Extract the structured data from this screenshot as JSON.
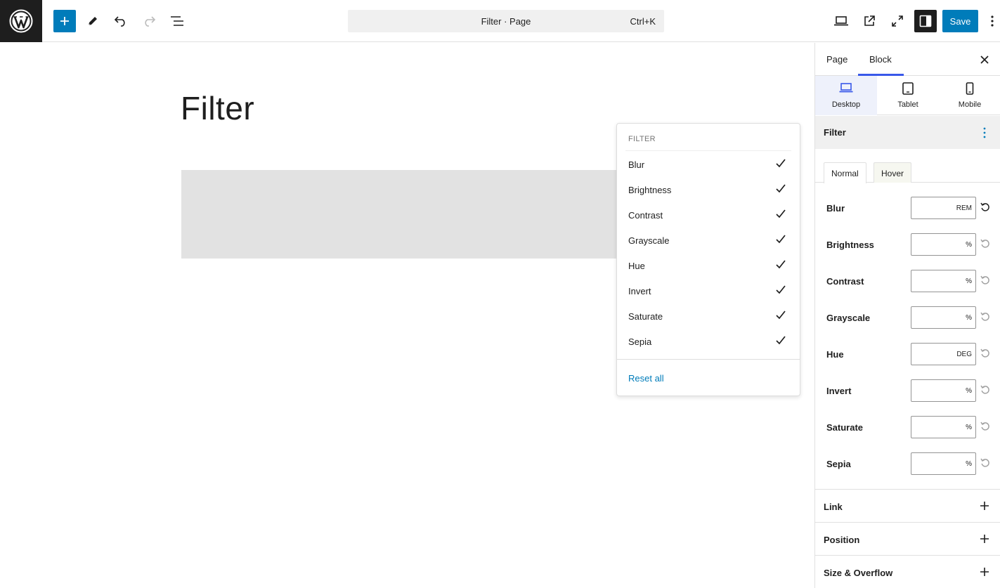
{
  "topbar": {
    "command_title": "Filter · Page",
    "command_shortcut": "Ctrl+K",
    "save_label": "Save",
    "icons": [
      "wordpress-logo",
      "plus-icon",
      "pencil-icon",
      "undo-icon",
      "redo-icon",
      "list-view-icon",
      "desktop-view-icon",
      "external-link-icon",
      "fullscreen-icon",
      "sidebar-toggle-icon",
      "more-vertical-icon"
    ]
  },
  "canvas": {
    "page_title": "Filter"
  },
  "dropdown": {
    "heading": "FILTER",
    "items": [
      {
        "label": "Blur",
        "checked": true
      },
      {
        "label": "Brightness",
        "checked": true
      },
      {
        "label": "Contrast",
        "checked": true
      },
      {
        "label": "Grayscale",
        "checked": true
      },
      {
        "label": "Hue",
        "checked": true
      },
      {
        "label": "Invert",
        "checked": true
      },
      {
        "label": "Saturate",
        "checked": true
      },
      {
        "label": "Sepia",
        "checked": true
      }
    ],
    "reset_label": "Reset all"
  },
  "sidebar": {
    "tabs": {
      "page": "Page",
      "block": "Block"
    },
    "active_tab": "Block",
    "devices": [
      {
        "label": "Desktop",
        "active": true
      },
      {
        "label": "Tablet",
        "active": false
      },
      {
        "label": "Mobile",
        "active": false
      }
    ],
    "panel_title": "Filter",
    "state_tabs": {
      "normal": "Normal",
      "hover": "Hover"
    },
    "fields": [
      {
        "label": "Blur",
        "value": "",
        "unit": "REM"
      },
      {
        "label": "Brightness",
        "value": "",
        "unit": "%"
      },
      {
        "label": "Contrast",
        "value": "",
        "unit": "%"
      },
      {
        "label": "Grayscale",
        "value": "",
        "unit": "%"
      },
      {
        "label": "Hue",
        "value": "",
        "unit": "DEG"
      },
      {
        "label": "Invert",
        "value": "",
        "unit": "%"
      },
      {
        "label": "Saturate",
        "value": "",
        "unit": "%"
      },
      {
        "label": "Sepia",
        "value": "",
        "unit": "%"
      }
    ],
    "accordions": [
      "Link",
      "Position",
      "Size & Overflow"
    ]
  },
  "colors": {
    "accent": "#007cba",
    "tab_indicator": "#3858e9",
    "dark": "#1e1e1e",
    "block_placeholder": "#e2e2e2"
  }
}
